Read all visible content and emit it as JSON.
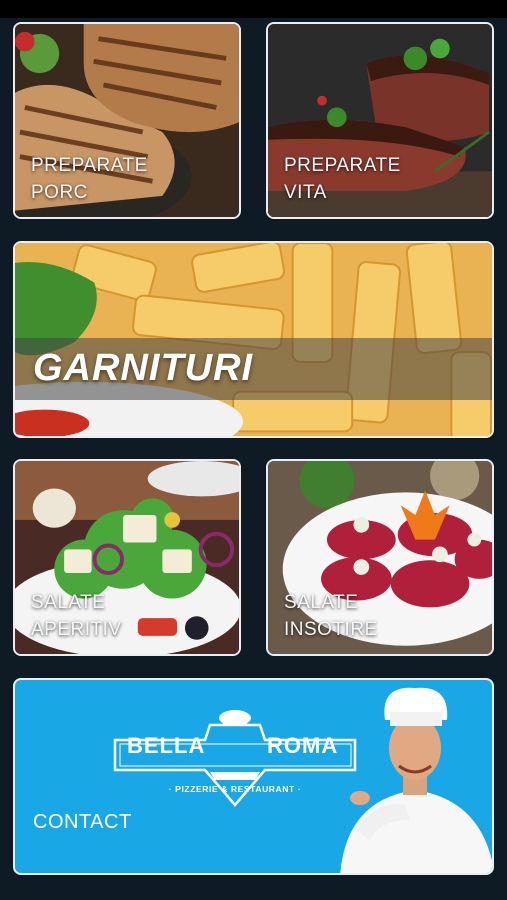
{
  "menu": {
    "porc": {
      "line1": "PREPARATE",
      "line2": "PORC"
    },
    "vita": {
      "line1": "PREPARATE",
      "line2": "VITA"
    },
    "garnituri": {
      "title": "GARNITURI"
    },
    "salate_aperitiv": {
      "line1": "SALATE",
      "line2": "APERITIV"
    },
    "salate_insotire": {
      "line1": "SALATE",
      "line2": "INSOTIRE"
    }
  },
  "contact": {
    "label": "CONTACT",
    "logo_name_left": "BELLA",
    "logo_name_right": "ROMA",
    "logo_tagline": "· PIZZERIE & RESTAURANT ·"
  },
  "colors": {
    "background": "#0f1b24",
    "contact_bg": "#1aa7e6",
    "card_border": "#e9eef2"
  },
  "icons": [
    "pork-chop-image",
    "beef-steak-image",
    "fries-image",
    "greek-salad-image",
    "beet-salad-image",
    "bella-roma-logo",
    "chef-image"
  ]
}
